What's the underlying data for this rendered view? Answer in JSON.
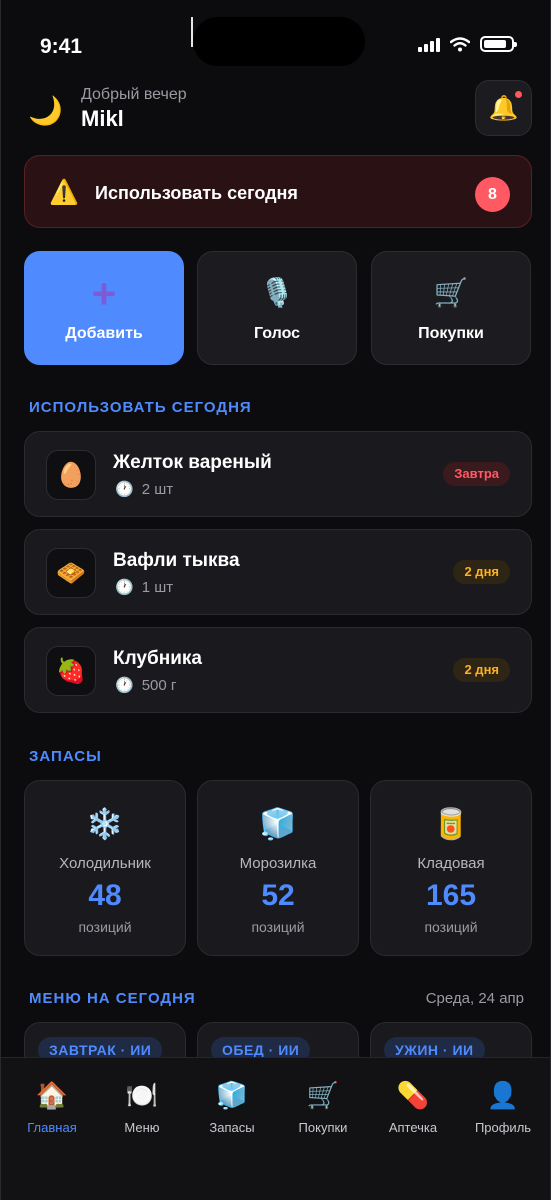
{
  "status_bar": {
    "time": "9:41"
  },
  "header": {
    "greeting": "Добрый вечер",
    "username": "Mikl"
  },
  "alert": {
    "text": "Использовать сегодня",
    "count": "8"
  },
  "quick_actions": [
    {
      "label": "Добавить",
      "icon": "plus-icon"
    },
    {
      "label": "Голос",
      "icon": "microphone-icon"
    },
    {
      "label": "Покупки",
      "icon": "shopping-cart-icon"
    }
  ],
  "use_today": {
    "title": "ИСПОЛЬЗОВАТЬ СЕГОДНЯ",
    "items": [
      {
        "name": "Желток вареный",
        "qty": "2 шт",
        "badge": "Завтра",
        "icon": "egg-icon",
        "badge_color": "#ff5a64"
      },
      {
        "name": "Вафли тыква",
        "qty": "1 шт",
        "badge": "2 дня",
        "icon": "waffle-icon",
        "badge_color": "#ffb020"
      },
      {
        "name": "Клубника",
        "qty": "500 г",
        "badge": "2 дня",
        "icon": "strawberry-icon",
        "badge_color": "#ffb020"
      }
    ]
  },
  "stock": {
    "title": "ЗАПАСЫ",
    "cards": [
      {
        "name": "Холодильник",
        "count": "48",
        "unit": "позиций",
        "icon": "snowflake-icon"
      },
      {
        "name": "Морозилка",
        "count": "52",
        "unit": "позиций",
        "icon": "ice-cube-icon"
      },
      {
        "name": "Кладовая",
        "count": "165",
        "unit": "позиций",
        "icon": "canned-food-icon"
      }
    ]
  },
  "menu": {
    "title": "МЕНЮ НА СЕГОДНЯ",
    "date": "Среда, 24 апр",
    "meals": [
      {
        "tag": "ЗАВТРАК · ИИ"
      },
      {
        "tag": "ОБЕД · ИИ"
      },
      {
        "tag": "УЖИН · ИИ"
      }
    ]
  },
  "tabs": [
    {
      "label": "Главная",
      "icon": "house-icon",
      "active": true
    },
    {
      "label": "Меню",
      "icon": "plate-cutlery-icon"
    },
    {
      "label": "Запасы",
      "icon": "ice-cube-icon"
    },
    {
      "label": "Покупки",
      "icon": "shopping-cart-icon"
    },
    {
      "label": "Аптечка",
      "icon": "pill-icon"
    },
    {
      "label": "Профиль",
      "icon": "user-silhouette-icon"
    }
  ],
  "colors": {
    "accent": "#4f8bff",
    "danger": "#ff5a64",
    "warning": "#ffb020",
    "background": "#0c0c0e"
  }
}
